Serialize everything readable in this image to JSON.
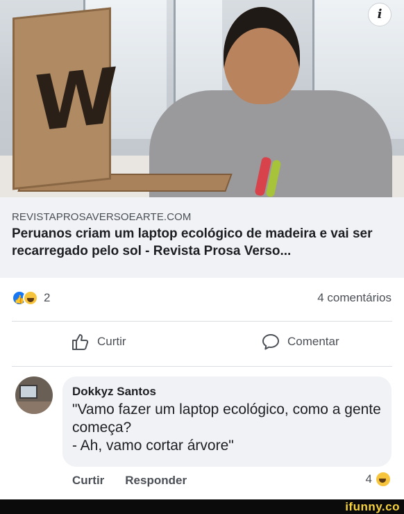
{
  "post": {
    "link": {
      "site": "REVISTAPROSAVERSOEARTE.COM",
      "title": "Peruanos criam um laptop ecológico de madeira e vai ser recarregado pelo sol - Revista Prosa Verso..."
    },
    "reactions": {
      "icons": [
        "like-icon",
        "haha-icon"
      ],
      "count": "2"
    },
    "comments_count": "4 comentários",
    "actions": {
      "like_label": "Curtir",
      "comment_label": "Comentar"
    }
  },
  "comment": {
    "author": "Dokkyz Santos",
    "text": "\"Vamo fazer um laptop ecológico, como a gente começa?\n- Ah, vamo cortar árvore\"",
    "like_label": "Curtir",
    "reply_label": "Responder",
    "reaction_count": "4",
    "reaction_icon": "haha-icon"
  },
  "watermark": "ifunny.co",
  "colors": {
    "accent": "#1877f2",
    "text": "#1c1e21",
    "muted": "#4b4f56",
    "bubble": "#f0f2f5",
    "watermark": "#f6d23d"
  }
}
